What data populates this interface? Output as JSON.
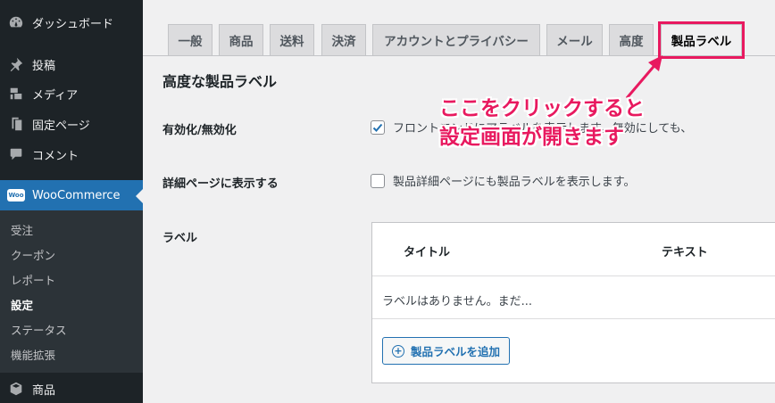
{
  "sidebar": {
    "items": [
      {
        "label": "ダッシュボード",
        "icon": "dashboard-icon"
      },
      {
        "label": "投稿",
        "icon": "pin-icon"
      },
      {
        "label": "メディア",
        "icon": "media-icon"
      },
      {
        "label": "固定ページ",
        "icon": "page-icon"
      },
      {
        "label": "コメント",
        "icon": "comment-icon"
      },
      {
        "label": "WooCommerce",
        "icon": "woocommerce-icon",
        "badge": "Woo"
      },
      {
        "label": "商品",
        "icon": "product-icon"
      }
    ],
    "submenu": [
      "受注",
      "クーポン",
      "レポート",
      "設定",
      "ステータス",
      "機能拡張"
    ],
    "active_submenu": "設定"
  },
  "tabs": [
    "一般",
    "商品",
    "送料",
    "決済",
    "アカウントとプライバシー",
    "メール",
    "高度",
    "製品ラベル"
  ],
  "active_tab": "製品ラベル",
  "content": {
    "title": "高度な製品ラベル",
    "enable_label": "有効化/無効化",
    "enable_text": "フロントエンドにアラベルを表示します。無効にしても、",
    "enable_checked": true,
    "detail_label": "詳細ページに表示する",
    "detail_text": "製品詳細ページにも製品ラベルを表示します。",
    "detail_checked": false,
    "labels_label": "ラベル",
    "table": {
      "col_title": "タイトル",
      "col_text": "テキスト",
      "empty": "ラベルはありません。まだ...",
      "add_button": "製品ラベルを追加"
    }
  },
  "annotation": {
    "line1": "ここをクリックすると",
    "line2": "設定画面が開きます",
    "color": "#e8195f"
  },
  "colors": {
    "sidebar_bg": "#1d2327",
    "accent": "#2271b1",
    "highlight": "#e8195f"
  }
}
